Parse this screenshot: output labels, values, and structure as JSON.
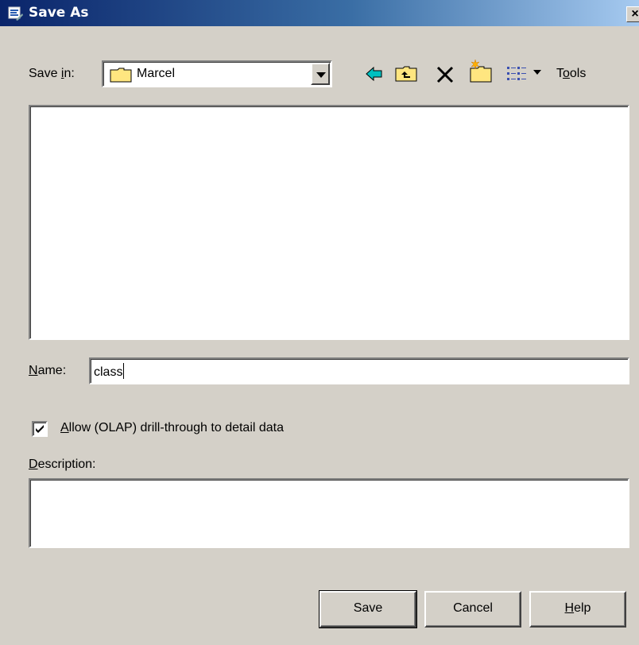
{
  "window": {
    "title": "Save As",
    "close_label": "×"
  },
  "save_in": {
    "label_pre": "Save ",
    "label_u": "i",
    "label_post": "n:",
    "value": "Marcel"
  },
  "toolbar": {
    "back_icon": "back-arrow-icon",
    "up_icon": "up-folder-icon",
    "delete_icon": "delete-x-icon",
    "new_folder_icon": "new-folder-icon",
    "views_icon": "views-list-icon",
    "tools_pre": "T",
    "tools_u": "o",
    "tools_post": "ols"
  },
  "name": {
    "label_u": "N",
    "label_post": "ame:",
    "value": "class"
  },
  "drill": {
    "checked": true,
    "label_u": "A",
    "label_post": "llow (OLAP) drill-through to detail data"
  },
  "description": {
    "label_u": "D",
    "label_post": "escription:",
    "value": ""
  },
  "buttons": {
    "save": "Save",
    "cancel": "Cancel",
    "help_u": "H",
    "help_post": "elp"
  },
  "colors": {
    "titlebar_start": "#0a246a",
    "titlebar_end": "#a6caf0",
    "dialog_bg": "#d4d0c8",
    "folder_yellow": "#ffe680",
    "back_arrow": "#00c0c0"
  }
}
